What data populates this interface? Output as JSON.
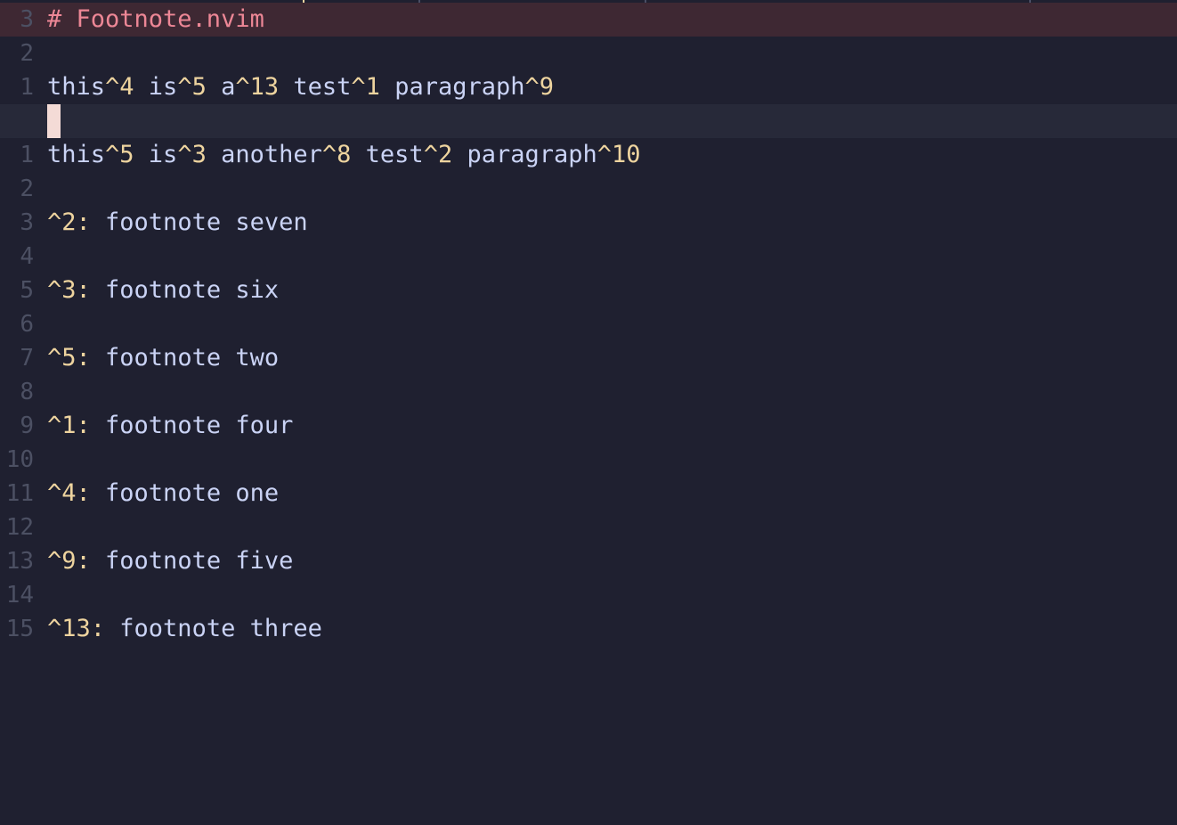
{
  "editor": {
    "lines": [
      {
        "num": "3",
        "parts": [
          {
            "t": "# Footnote.nvim",
            "c": "heading"
          }
        ],
        "row": "heading"
      },
      {
        "num": "2",
        "parts": []
      },
      {
        "num": "1",
        "parts": [
          {
            "t": "this",
            "c": "plain"
          },
          {
            "t": "^4",
            "c": "ref"
          },
          {
            "t": " is",
            "c": "plain"
          },
          {
            "t": "^5",
            "c": "ref"
          },
          {
            "t": " a",
            "c": "plain"
          },
          {
            "t": "^13",
            "c": "ref"
          },
          {
            "t": " test",
            "c": "plain"
          },
          {
            "t": "^1",
            "c": "ref"
          },
          {
            "t": " paragraph",
            "c": "plain"
          },
          {
            "t": "^9",
            "c": "ref"
          }
        ]
      },
      {
        "num": "",
        "parts": [],
        "row": "cursor"
      },
      {
        "num": "1",
        "parts": [
          {
            "t": "this",
            "c": "plain"
          },
          {
            "t": "^5",
            "c": "ref"
          },
          {
            "t": " is",
            "c": "plain"
          },
          {
            "t": "^3",
            "c": "ref"
          },
          {
            "t": " another",
            "c": "plain"
          },
          {
            "t": "^8",
            "c": "ref"
          },
          {
            "t": " test",
            "c": "plain"
          },
          {
            "t": "^2",
            "c": "ref"
          },
          {
            "t": " paragraph",
            "c": "plain"
          },
          {
            "t": "^10",
            "c": "ref"
          }
        ]
      },
      {
        "num": "2",
        "parts": []
      },
      {
        "num": "3",
        "parts": [
          {
            "t": "^2:",
            "c": "ref"
          },
          {
            "t": " footnote seven",
            "c": "plain"
          }
        ]
      },
      {
        "num": "4",
        "parts": []
      },
      {
        "num": "5",
        "parts": [
          {
            "t": "^3:",
            "c": "ref"
          },
          {
            "t": " footnote six",
            "c": "plain"
          }
        ]
      },
      {
        "num": "6",
        "parts": []
      },
      {
        "num": "7",
        "parts": [
          {
            "t": "^5:",
            "c": "ref"
          },
          {
            "t": " footnote two",
            "c": "plain"
          }
        ]
      },
      {
        "num": "8",
        "parts": []
      },
      {
        "num": "9",
        "parts": [
          {
            "t": "^1:",
            "c": "ref"
          },
          {
            "t": " footnote four",
            "c": "plain"
          }
        ]
      },
      {
        "num": "10",
        "parts": []
      },
      {
        "num": "11",
        "parts": [
          {
            "t": "^4:",
            "c": "ref"
          },
          {
            "t": " footnote one",
            "c": "plain"
          }
        ]
      },
      {
        "num": "12",
        "parts": []
      },
      {
        "num": "13",
        "parts": [
          {
            "t": "^9:",
            "c": "ref"
          },
          {
            "t": " footnote five",
            "c": "plain"
          }
        ]
      },
      {
        "num": "14",
        "parts": []
      },
      {
        "num": "15",
        "parts": [
          {
            "t": "^13:",
            "c": "ref"
          },
          {
            "t": " footnote three",
            "c": "plain"
          }
        ]
      }
    ]
  },
  "colors": {
    "background": "#1f2030",
    "text": "#cad3f5",
    "heading": "#ed8796",
    "footnote_ref": "#eed49f",
    "line_number": "#4c5063",
    "cursor": "#f4dbd6"
  }
}
